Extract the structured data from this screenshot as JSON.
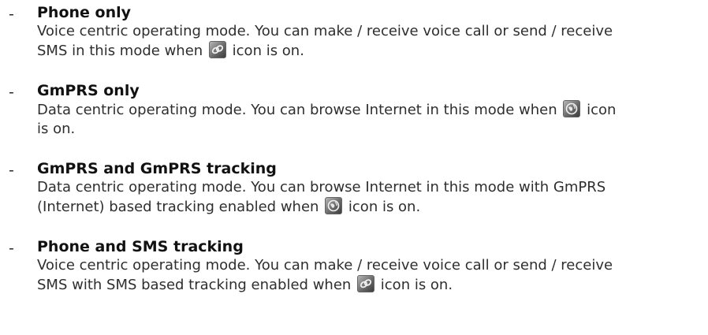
{
  "items": [
    {
      "bullet": "-",
      "title": "Phone only",
      "line1": "Voice centric operating mode. You can make / receive voice call or send / receive",
      "line2_before": "SMS in this mode when",
      "icon": "phone-chain-icon",
      "line2_after": "icon is on."
    },
    {
      "bullet": "-",
      "title": "GmPRS only",
      "line1_before": "Data centric operating mode. You can browse Internet in this mode when",
      "icon": "globe-data-icon",
      "line1_after": "icon",
      "line2": "is on."
    },
    {
      "bullet": "-",
      "title": "GmPRS and GmPRS tracking",
      "line1": "Data centric operating mode. You can browse Internet in this mode with GmPRS",
      "line2_before": "(Internet) based tracking enabled when",
      "icon": "globe-data-icon",
      "line2_after": "icon is on."
    },
    {
      "bullet": "-",
      "title": "Phone and SMS tracking",
      "line1": "Voice centric operating mode. You can make / receive voice call or send / receive",
      "line2_before": "SMS with SMS based tracking enabled when",
      "icon": "phone-chain-icon",
      "line2_after": "icon is on."
    }
  ]
}
